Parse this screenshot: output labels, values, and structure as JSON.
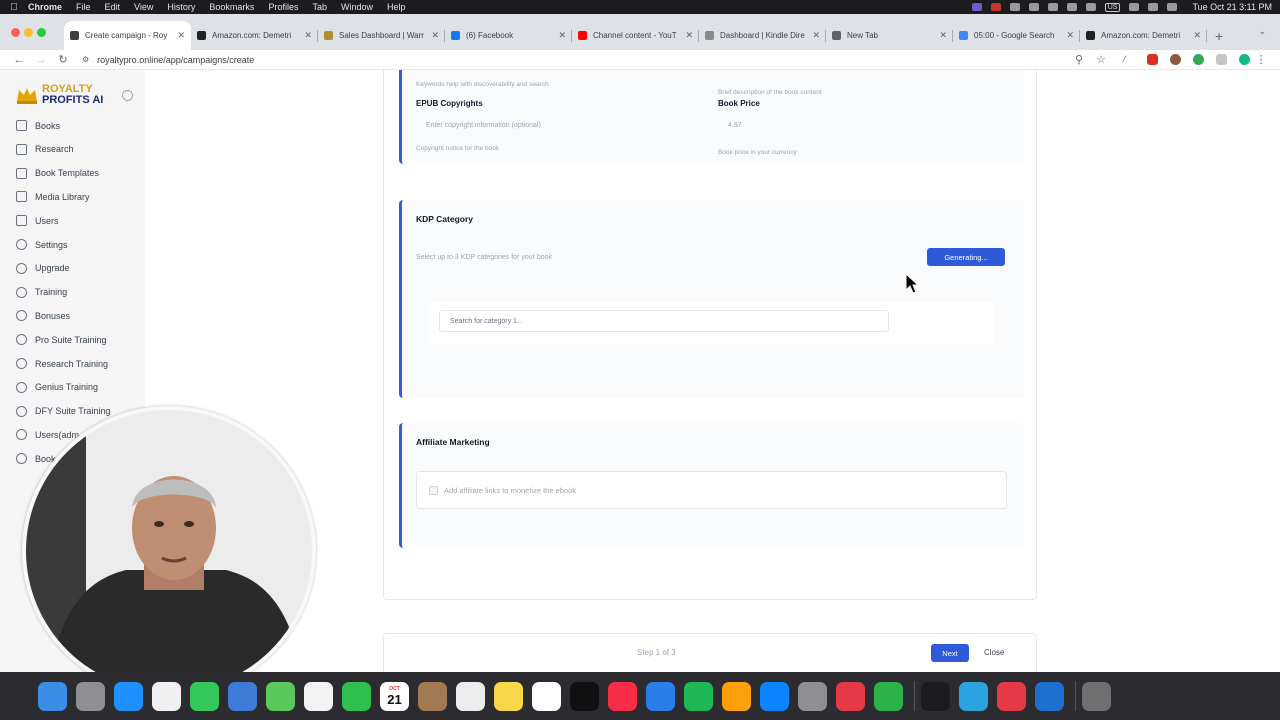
{
  "menubar": {
    "app": "Chrome",
    "items": [
      "File",
      "Edit",
      "View",
      "History",
      "Bookmarks",
      "Profiles",
      "Tab",
      "Window",
      "Help"
    ],
    "lang": "US",
    "clock": "Tue Oct 21  3:11 PM"
  },
  "browser": {
    "tabs": [
      {
        "title": "Create campaign - Roy",
        "favicon_color": "#3c4043",
        "active": true
      },
      {
        "title": "Amazon.com: Demetri",
        "favicon_color": "#222222"
      },
      {
        "title": "Sales Dashboard | Warr",
        "favicon_color": "#b08d2f"
      },
      {
        "title": "(6) Facebook",
        "favicon_color": "#1877f2"
      },
      {
        "title": "Channel content - YouT",
        "favicon_color": "#ff0000"
      },
      {
        "title": "Dashboard | Kindle Dire",
        "favicon_color": "#8a8a8a"
      },
      {
        "title": "New Tab",
        "favicon_color": "#5f6368"
      },
      {
        "title": "05:00 - Google Search",
        "favicon_color": "#4285f4"
      },
      {
        "title": "Amazon.com: Demetri",
        "favicon_color": "#222222"
      }
    ],
    "new_tab": "+",
    "url": "royaltypro.online/app/campaigns/create"
  },
  "sidebar": {
    "logo_line1": "ROYALTY",
    "logo_line2": "PROFITS AI",
    "items": [
      {
        "label": "Books",
        "icon": "book-icon"
      },
      {
        "label": "Research",
        "icon": "search-icon"
      },
      {
        "label": "Book Templates",
        "icon": "template-icon"
      },
      {
        "label": "Media Library",
        "icon": "image-icon"
      },
      {
        "label": "Users",
        "icon": "user-icon"
      },
      {
        "label": "Settings",
        "icon": "gear-icon"
      },
      {
        "label": "Upgrade",
        "icon": "upgrade-icon"
      },
      {
        "label": "Training",
        "icon": "training-icon"
      },
      {
        "label": "Bonuses",
        "icon": "gift-icon"
      },
      {
        "label": "Pro Suite Training",
        "icon": "training-icon"
      },
      {
        "label": "Research Training",
        "icon": "training-icon"
      },
      {
        "label": "Genius Training",
        "icon": "training-icon"
      },
      {
        "label": "DFY Suite Training",
        "icon": "training-icon"
      },
      {
        "label": "Users(adm",
        "icon": "user-icon"
      },
      {
        "label": "Book",
        "icon": "book-icon"
      }
    ]
  },
  "form": {
    "keywords_help": "Keywords help with discoverability and search",
    "description_help": "Brief description of the book content",
    "epub_label": "EPUB Copyrights",
    "epub_placeholder": "Enter copyright information (optional)",
    "epub_help": "Copyright notice for the book",
    "price_label": "Book Price",
    "price_placeholder": "4.97",
    "price_help": "Book price in your currency",
    "kdp_title": "KDP Category",
    "kdp_help": "Select up to 3 KDP categories for your book",
    "generating_label": "Generating...",
    "category_placeholder": "Search for category 1...",
    "affiliate_title": "Affiliate Marketing",
    "affiliate_label": "Add affiliate links to monetize the ebook"
  },
  "footer": {
    "step": "Step 1 of 3",
    "next": "Next",
    "close": "Close"
  },
  "colors": {
    "accent": "#2f5bd8",
    "section_border": "#3b5bdb",
    "logo_gold": "#d4a017",
    "logo_navy": "#1e2a78"
  },
  "dock": {
    "calendar_month": "OCT",
    "calendar_day": "21",
    "apps": [
      "finder-icon",
      "launchpad-icon",
      "safari-icon",
      "chrome-icon",
      "messages-icon",
      "mail-icon",
      "maps-icon",
      "photos-icon",
      "facetime-icon",
      "calendar-icon",
      "contacts-icon",
      "reminders-icon",
      "notes-icon",
      "freeform-icon",
      "appletv-icon",
      "music-icon",
      "keynote-icon",
      "numbers-icon",
      "pages-icon",
      "appstore-icon",
      "settings-icon",
      "parallels-icon",
      "camtasia-icon",
      "terminal-icon",
      "telegram-icon",
      "recorder-icon",
      "vscode-icon",
      "trash-icon"
    ]
  }
}
